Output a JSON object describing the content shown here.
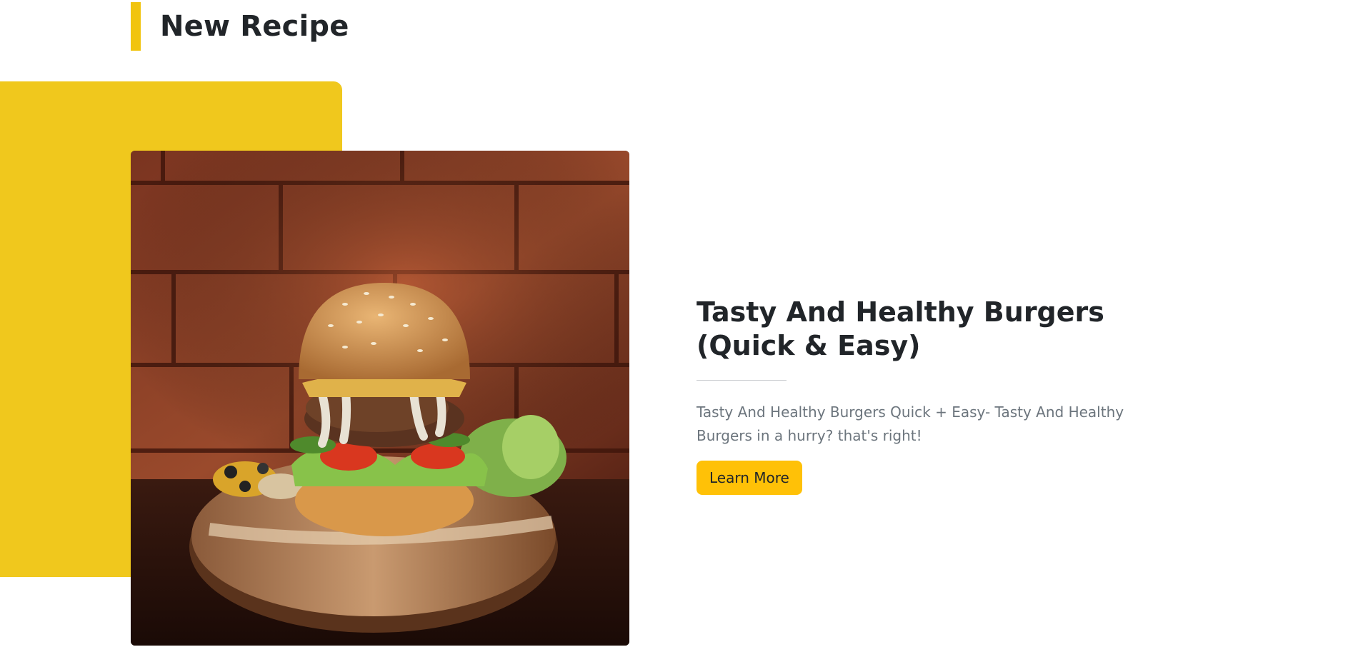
{
  "section": {
    "title": "New Recipe",
    "accent_color": "#f1c40f"
  },
  "featured_recipe": {
    "image_icon": "burger-photo",
    "title": "Tasty And Healthy Burgers (Quick & Easy)",
    "description": "Tasty And Healthy Burgers Quick + Easy- Tasty And Healthy Burgers in a hurry? that's right!",
    "button_label": "Learn More",
    "button_color": "#ffc107"
  }
}
